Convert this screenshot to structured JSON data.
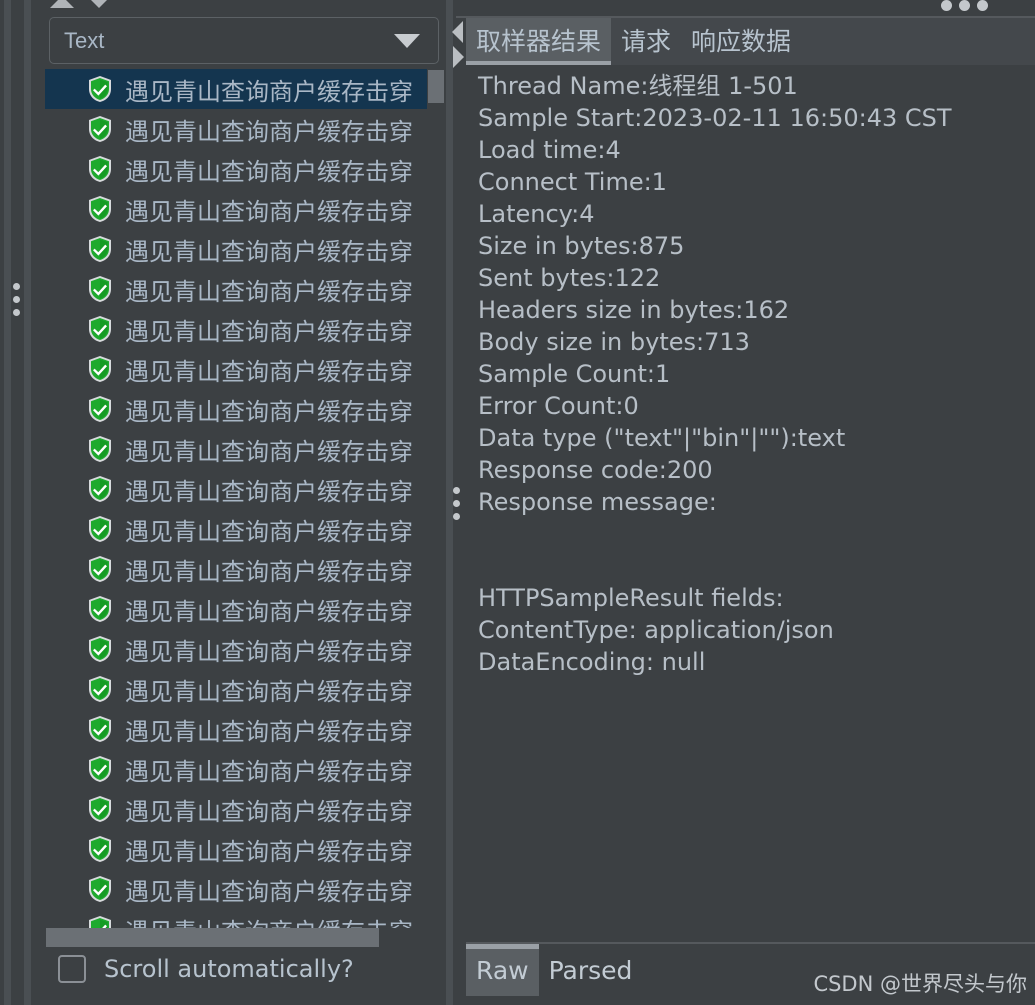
{
  "left_panel": {
    "combo": {
      "selected": "Text",
      "options": [
        "Text"
      ]
    },
    "list": {
      "items": [
        {
          "label": "遇见青山查询商户缓存击穿",
          "status": "ok",
          "selected": true
        },
        {
          "label": "遇见青山查询商户缓存击穿",
          "status": "ok",
          "selected": false
        },
        {
          "label": "遇见青山查询商户缓存击穿",
          "status": "ok",
          "selected": false
        },
        {
          "label": "遇见青山查询商户缓存击穿",
          "status": "ok",
          "selected": false
        },
        {
          "label": "遇见青山查询商户缓存击穿",
          "status": "ok",
          "selected": false
        },
        {
          "label": "遇见青山查询商户缓存击穿",
          "status": "ok",
          "selected": false
        },
        {
          "label": "遇见青山查询商户缓存击穿",
          "status": "ok",
          "selected": false
        },
        {
          "label": "遇见青山查询商户缓存击穿",
          "status": "ok",
          "selected": false
        },
        {
          "label": "遇见青山查询商户缓存击穿",
          "status": "ok",
          "selected": false
        },
        {
          "label": "遇见青山查询商户缓存击穿",
          "status": "ok",
          "selected": false
        },
        {
          "label": "遇见青山查询商户缓存击穿",
          "status": "ok",
          "selected": false
        },
        {
          "label": "遇见青山查询商户缓存击穿",
          "status": "ok",
          "selected": false
        },
        {
          "label": "遇见青山查询商户缓存击穿",
          "status": "ok",
          "selected": false
        },
        {
          "label": "遇见青山查询商户缓存击穿",
          "status": "ok",
          "selected": false
        },
        {
          "label": "遇见青山查询商户缓存击穿",
          "status": "ok",
          "selected": false
        },
        {
          "label": "遇见青山查询商户缓存击穿",
          "status": "ok",
          "selected": false
        },
        {
          "label": "遇见青山查询商户缓存击穿",
          "status": "ok",
          "selected": false
        },
        {
          "label": "遇见青山查询商户缓存击穿",
          "status": "ok",
          "selected": false
        },
        {
          "label": "遇见青山查询商户缓存击穿",
          "status": "ok",
          "selected": false
        },
        {
          "label": "遇见青山查询商户缓存击穿",
          "status": "ok",
          "selected": false
        },
        {
          "label": "遇见青山查询商户缓存击穿",
          "status": "ok",
          "selected": false
        },
        {
          "label": "遇见青山查询商户缓存击穿",
          "status": "ok",
          "selected": false
        }
      ]
    },
    "scroll_checkbox": {
      "label": "Scroll automatically?",
      "checked": false
    }
  },
  "right_panel": {
    "tabs": [
      {
        "label": "取样器结果",
        "active": true
      },
      {
        "label": "请求",
        "active": false
      },
      {
        "label": "响应数据",
        "active": false
      }
    ],
    "result_lines": [
      "Thread Name:线程组 1-501",
      "Sample Start:2023-02-11 16:50:43 CST",
      "Load time:4",
      "Connect Time:1",
      "Latency:4",
      "Size in bytes:875",
      "Sent bytes:122",
      "Headers size in bytes:162",
      "Body size in bytes:713",
      "Sample Count:1",
      "Error Count:0",
      "Data type (\"text\"|\"bin\"|\"\"):text",
      "Response code:200",
      "Response message:",
      "",
      "",
      "HTTPSampleResult fields:",
      "ContentType: application/json",
      "DataEncoding: null"
    ],
    "bottom_tabs": [
      {
        "label": "Raw",
        "active": true
      },
      {
        "label": "Parsed",
        "active": false
      }
    ]
  },
  "watermark": "CSDN @世界尽头与你",
  "colors": {
    "panel_bg": "#3c4043",
    "selection_bg": "#14354f",
    "text": "#b7bfc7",
    "accent_green": "#2eb83c",
    "tab_active_bg": "#5a5f63"
  }
}
